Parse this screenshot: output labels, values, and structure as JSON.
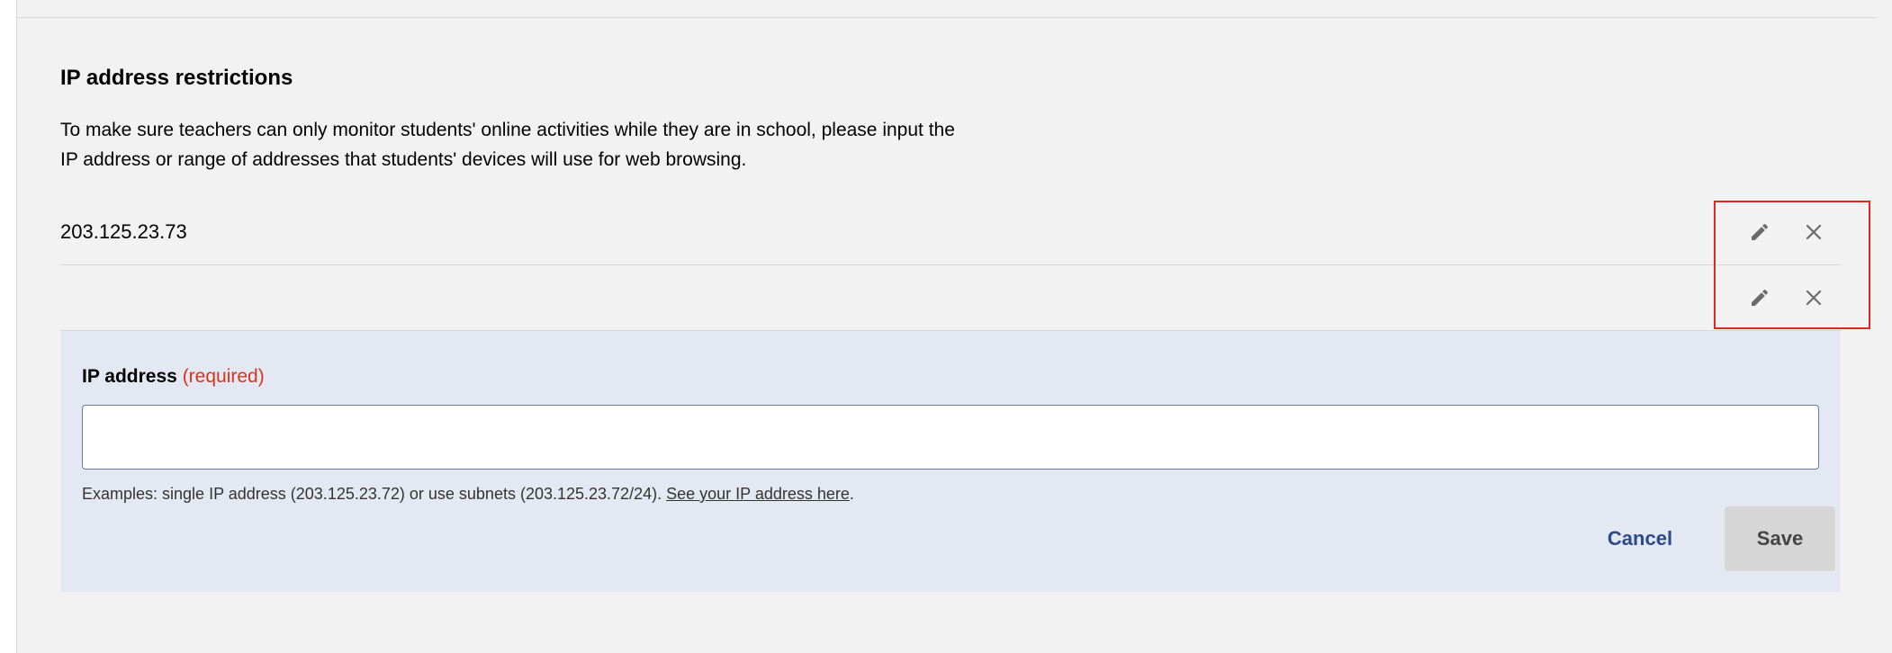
{
  "section": {
    "title": "IP address restrictions",
    "description": "To make sure teachers can only monitor students' online activities while they are in school, please input the IP address or range of addresses that students' devices will use for web browsing."
  },
  "ip_list": [
    {
      "value": "203.125.23.73",
      "edit_icon": "pencil-icon",
      "remove_icon": "close-icon"
    },
    {
      "value": "",
      "edit_icon": "pencil-icon",
      "remove_icon": "close-icon"
    }
  ],
  "form": {
    "label": "IP address",
    "required_text": "(required)",
    "input_value": "",
    "input_placeholder": "",
    "hint_prefix": "Examples: single IP address (203.125.23.72) or use subnets (203.125.23.72/24). ",
    "hint_link": "See your IP address here",
    "hint_suffix": ".",
    "cancel_label": "Cancel",
    "save_label": "Save"
  },
  "colors": {
    "background": "#f2f2f2",
    "form_panel": "#e4e8f2",
    "required": "#d4351c",
    "link_button": "#2b4a8b",
    "highlight": "#e0261d",
    "save_disabled": "#d6d6d6"
  }
}
